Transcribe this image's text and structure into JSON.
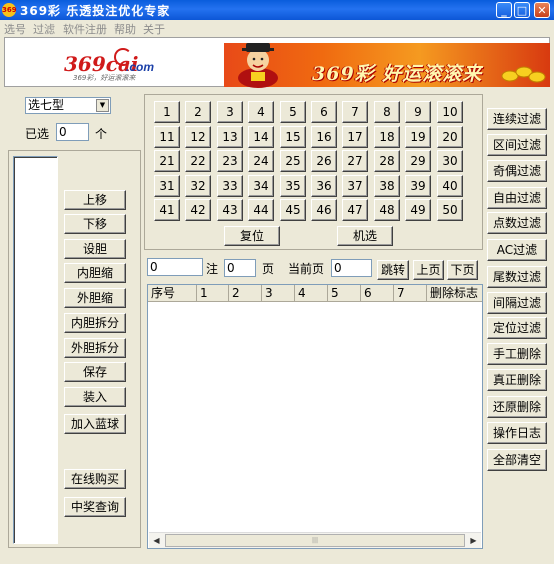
{
  "window": {
    "title": "369彩  乐透投注优化专家",
    "icon_text": "369",
    "minimize_glyph": "_",
    "maximize_glyph": "□",
    "close_glyph": "✕"
  },
  "menu": [
    "选号",
    "过滤",
    "软件注册",
    "帮助",
    "关于"
  ],
  "header": {
    "logo_text": "369cai",
    "logo_com": ".com",
    "logo_slogan": "369彩，好运滚滚来",
    "banner_text": "369彩  好运滚滚来"
  },
  "left_panel": {
    "type_select_value": "选七型",
    "selected_label": "已选",
    "selected_count": "0",
    "selected_unit": "个",
    "buttons": [
      "上移",
      "下移",
      "设胆",
      "内胆缩",
      "外胆缩",
      "内胆拆分",
      "外胆拆分",
      "保存",
      "装入",
      "加入蓝球"
    ],
    "bottom_buttons": [
      "在线购买",
      "中奖查询"
    ]
  },
  "number_grid": {
    "numbers": [
      "1",
      "2",
      "3",
      "4",
      "5",
      "6",
      "7",
      "8",
      "9",
      "10",
      "11",
      "12",
      "13",
      "14",
      "15",
      "16",
      "17",
      "18",
      "19",
      "20",
      "21",
      "22",
      "23",
      "24",
      "25",
      "26",
      "27",
      "28",
      "29",
      "30",
      "31",
      "32",
      "33",
      "34",
      "35",
      "36",
      "37",
      "38",
      "39",
      "40",
      "41",
      "42",
      "43",
      "44",
      "45",
      "46",
      "47",
      "48",
      "49",
      "50"
    ],
    "reset_label": "复位",
    "random_label": "机选"
  },
  "pager": {
    "notes_value": "0",
    "notes_label": "注",
    "pages_value": "0",
    "pages_label": "页",
    "current_label": "当前页",
    "current_value": "0",
    "jump_label": "跳转",
    "prev_label": "上页",
    "next_label": "下页"
  },
  "table": {
    "columns": [
      "序号",
      "1",
      "2",
      "3",
      "4",
      "5",
      "6",
      "7",
      "删除标志"
    ],
    "rows": []
  },
  "right_buttons": [
    "连续过滤",
    "区间过滤",
    "奇偶过滤",
    "自由过滤",
    "点数过滤",
    "AC过滤",
    "尾数过滤",
    "间隔过滤",
    "定位过滤",
    "手工删除",
    "真正删除",
    "还原删除",
    "操作日志",
    "全部清空"
  ],
  "colors": {
    "titlebar": "#0a5ddc",
    "background": "#ece9d8",
    "banner": "#e84a18",
    "logo_red": "#d01a1a",
    "logo_blue": "#1a3fa8"
  }
}
